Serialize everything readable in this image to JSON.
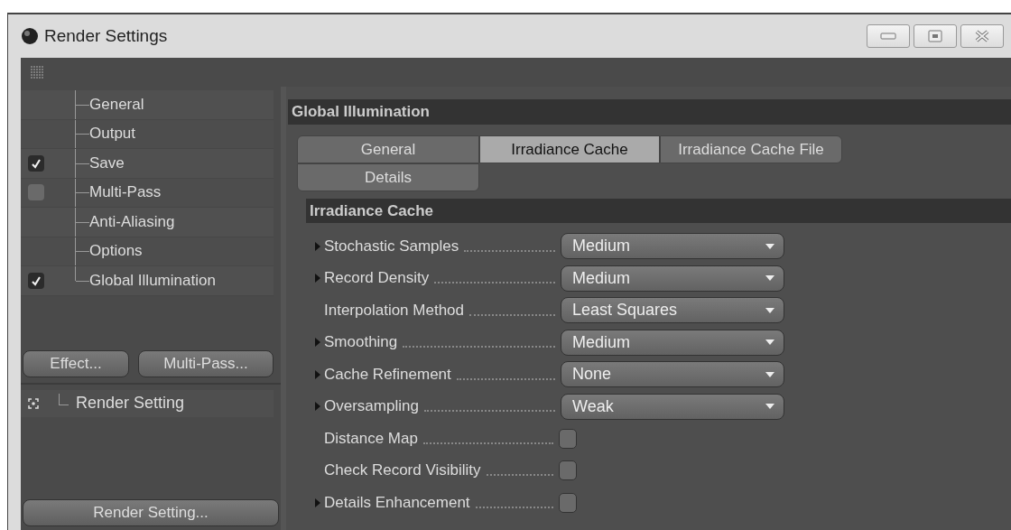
{
  "window": {
    "title": "Render Settings"
  },
  "tree": [
    {
      "label": "General",
      "kind": "plain"
    },
    {
      "label": "Output",
      "kind": "plain"
    },
    {
      "label": "Save",
      "kind": "checkbox",
      "checked": true
    },
    {
      "label": "Multi-Pass",
      "kind": "checkbox",
      "checked": false
    },
    {
      "label": "Anti-Aliasing",
      "kind": "plain"
    },
    {
      "label": "Options",
      "kind": "plain"
    },
    {
      "label": "Global Illumination",
      "kind": "checkbox",
      "checked": true
    }
  ],
  "left_buttons": [
    "Effect...",
    "Multi-Pass..."
  ],
  "settings_list": [
    {
      "label": "Render Setting"
    }
  ],
  "bottom_button": "Render Setting...",
  "section_title": "Global Illumination",
  "tabs": [
    {
      "label": "General",
      "selected": false
    },
    {
      "label": "Irradiance Cache",
      "selected": true
    },
    {
      "label": "Irradiance Cache File",
      "selected": false
    },
    {
      "label": "Details",
      "selected": false
    }
  ],
  "group_title": "Irradiance Cache",
  "settings": [
    {
      "label": "Stochastic Samples",
      "expandable": true,
      "kind": "dropdown",
      "value": "Medium"
    },
    {
      "label": "Record Density",
      "expandable": true,
      "kind": "dropdown",
      "value": "Medium"
    },
    {
      "label": "Interpolation Method",
      "expandable": false,
      "kind": "dropdown",
      "value": "Least Squares"
    },
    {
      "label": "Smoothing",
      "expandable": true,
      "kind": "dropdown",
      "value": "Medium"
    },
    {
      "label": "Cache Refinement",
      "expandable": true,
      "kind": "dropdown",
      "value": "None"
    },
    {
      "label": "Oversampling",
      "expandable": true,
      "kind": "dropdown",
      "value": "Weak"
    },
    {
      "label": "Distance Map",
      "expandable": false,
      "kind": "checkbox",
      "checked": false
    },
    {
      "label": "Check Record Visibility",
      "expandable": false,
      "kind": "checkbox",
      "checked": false
    },
    {
      "label": "Details Enhancement",
      "expandable": true,
      "kind": "checkbox",
      "checked": false
    }
  ]
}
